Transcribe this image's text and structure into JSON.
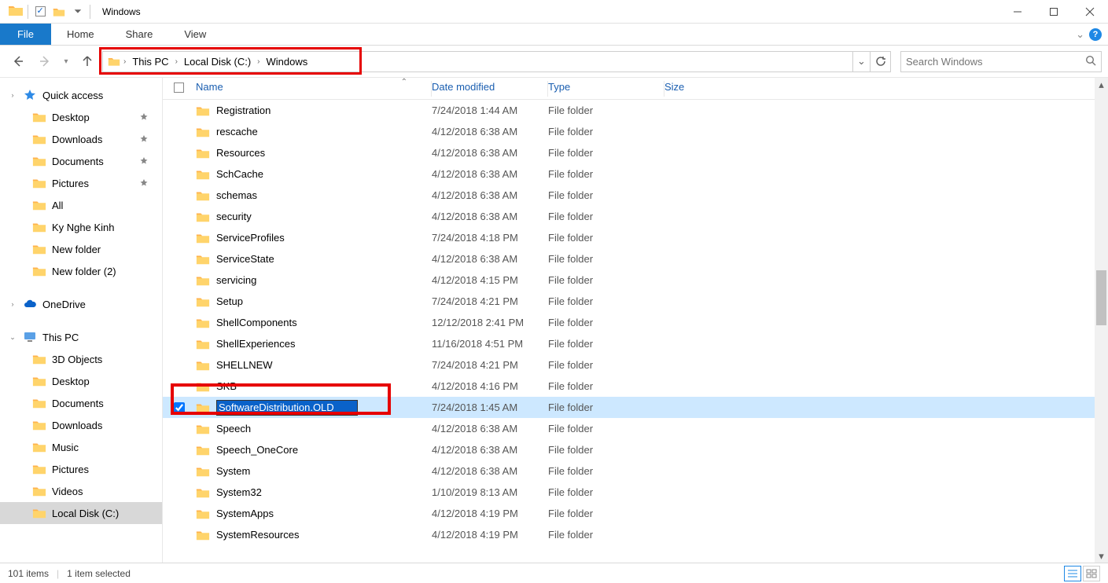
{
  "window_title": "Windows",
  "ribbon": {
    "file": "File",
    "tabs": [
      "Home",
      "Share",
      "View"
    ]
  },
  "nav": {
    "history_dropdown": "▾"
  },
  "breadcrumb": [
    "This PC",
    "Local Disk (C:)",
    "Windows"
  ],
  "search_placeholder": "Search Windows",
  "columns": {
    "name": "Name",
    "date": "Date modified",
    "type": "Type",
    "size": "Size"
  },
  "sidebar": {
    "quick_access": {
      "label": "Quick access",
      "items": [
        {
          "label": "Desktop",
          "pinned": true
        },
        {
          "label": "Downloads",
          "pinned": true
        },
        {
          "label": "Documents",
          "pinned": true
        },
        {
          "label": "Pictures",
          "pinned": true
        },
        {
          "label": "All",
          "pinned": false
        },
        {
          "label": "Ky Nghe Kinh",
          "pinned": false
        },
        {
          "label": "New folder",
          "pinned": false
        },
        {
          "label": "New folder (2)",
          "pinned": false
        }
      ]
    },
    "onedrive": {
      "label": "OneDrive"
    },
    "this_pc": {
      "label": "This PC",
      "items": [
        {
          "label": "3D Objects"
        },
        {
          "label": "Desktop"
        },
        {
          "label": "Documents"
        },
        {
          "label": "Downloads"
        },
        {
          "label": "Music"
        },
        {
          "label": "Pictures"
        },
        {
          "label": "Videos"
        },
        {
          "label": "Local Disk (C:)",
          "selected": true
        }
      ]
    }
  },
  "files": [
    {
      "name": "Registration",
      "date": "7/24/2018 1:44 AM",
      "type": "File folder"
    },
    {
      "name": "rescache",
      "date": "4/12/2018 6:38 AM",
      "type": "File folder"
    },
    {
      "name": "Resources",
      "date": "4/12/2018 6:38 AM",
      "type": "File folder"
    },
    {
      "name": "SchCache",
      "date": "4/12/2018 6:38 AM",
      "type": "File folder"
    },
    {
      "name": "schemas",
      "date": "4/12/2018 6:38 AM",
      "type": "File folder"
    },
    {
      "name": "security",
      "date": "4/12/2018 6:38 AM",
      "type": "File folder"
    },
    {
      "name": "ServiceProfiles",
      "date": "7/24/2018 4:18 PM",
      "type": "File folder"
    },
    {
      "name": "ServiceState",
      "date": "4/12/2018 6:38 AM",
      "type": "File folder"
    },
    {
      "name": "servicing",
      "date": "4/12/2018 4:15 PM",
      "type": "File folder"
    },
    {
      "name": "Setup",
      "date": "7/24/2018 4:21 PM",
      "type": "File folder"
    },
    {
      "name": "ShellComponents",
      "date": "12/12/2018 2:41 PM",
      "type": "File folder"
    },
    {
      "name": "ShellExperiences",
      "date": "11/16/2018 4:51 PM",
      "type": "File folder"
    },
    {
      "name": "SHELLNEW",
      "date": "7/24/2018 4:21 PM",
      "type": "File folder"
    },
    {
      "name": "SKB",
      "date": "4/12/2018 4:16 PM",
      "type": "File folder"
    },
    {
      "name": "SoftwareDistribution.OLD",
      "date": "7/24/2018 1:45 AM",
      "type": "File folder",
      "selected": true,
      "editing": true,
      "highlight": true
    },
    {
      "name": "Speech",
      "date": "4/12/2018 6:38 AM",
      "type": "File folder"
    },
    {
      "name": "Speech_OneCore",
      "date": "4/12/2018 6:38 AM",
      "type": "File folder"
    },
    {
      "name": "System",
      "date": "4/12/2018 6:38 AM",
      "type": "File folder"
    },
    {
      "name": "System32",
      "date": "1/10/2019 8:13 AM",
      "type": "File folder"
    },
    {
      "name": "SystemApps",
      "date": "4/12/2018 4:19 PM",
      "type": "File folder"
    },
    {
      "name": "SystemResources",
      "date": "4/12/2018 4:19 PM",
      "type": "File folder"
    }
  ],
  "status": {
    "count": "101 items",
    "selected": "1 item selected"
  },
  "icons": {
    "folder_fill": "#ffd46b",
    "folder_tab": "#ffb24c"
  }
}
